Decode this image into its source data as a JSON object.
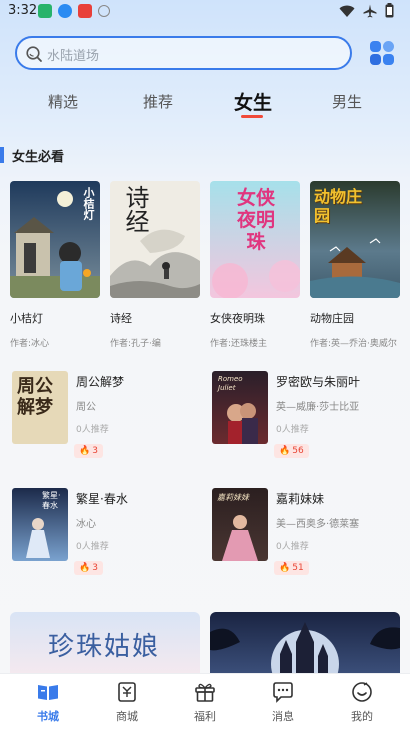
{
  "status_bar": {
    "time": "3:32",
    "app_icons": [
      "app-green-icon",
      "app-blue-download-icon",
      "app-red-icon",
      "info-icon"
    ],
    "right_icons": [
      "wifi-icon",
      "airplane-icon",
      "battery-icon"
    ]
  },
  "search": {
    "placeholder": "水陆道场",
    "grid_icon": "category-grid-icon"
  },
  "tabs": [
    {
      "label": "精选",
      "active": false
    },
    {
      "label": "推荐",
      "active": false
    },
    {
      "label": "女生",
      "active": true
    },
    {
      "label": "男生",
      "active": false
    }
  ],
  "section": {
    "title": "女生必看"
  },
  "featured_books": [
    {
      "title": "小桔灯",
      "author": "作者:冰心",
      "cover_text": "小桔灯"
    },
    {
      "title": "诗经",
      "author": "作者:孔子·编",
      "cover_text": "诗经"
    },
    {
      "title": "女侠夜明珠",
      "author": "作者:还珠楼主",
      "cover_text": "女侠夜明珠"
    },
    {
      "title": "动物庄园",
      "author": "作者:英—乔治·奥威尔",
      "cover_text": "动物庄园"
    }
  ],
  "list_books": [
    {
      "title": "周公解梦",
      "author": "周公",
      "recommend": "0人推荐",
      "hot": "3",
      "cover_text": "周公解梦"
    },
    {
      "title": "罗密欧与朱丽叶",
      "author": "英—威廉·莎士比亚",
      "recommend": "0人推荐",
      "hot": "56",
      "cover_text": "Romeo Juliet"
    },
    {
      "title": "繁星·春水",
      "author": "冰心",
      "recommend": "0人推荐",
      "hot": "3",
      "cover_text": "繁星·春水"
    },
    {
      "title": "嘉莉妹妹",
      "author": "美—西奥多·德莱塞",
      "recommend": "0人推荐",
      "hot": "51",
      "cover_text": "嘉莉妹妹"
    }
  ],
  "banners": [
    {
      "text": "珍珠姑娘"
    },
    {
      "text": ""
    }
  ],
  "bottom_nav": [
    {
      "label": "书城",
      "icon": "bookstore-icon",
      "active": true
    },
    {
      "label": "商城",
      "icon": "shop-icon",
      "active": false
    },
    {
      "label": "福利",
      "icon": "gift-icon",
      "active": false
    },
    {
      "label": "消息",
      "icon": "message-icon",
      "active": false
    },
    {
      "label": "我的",
      "icon": "profile-icon",
      "active": false
    }
  ],
  "colors": {
    "accent": "#3a7bea",
    "tab_indicator": "#f04a3a",
    "hot": "#e94535"
  }
}
